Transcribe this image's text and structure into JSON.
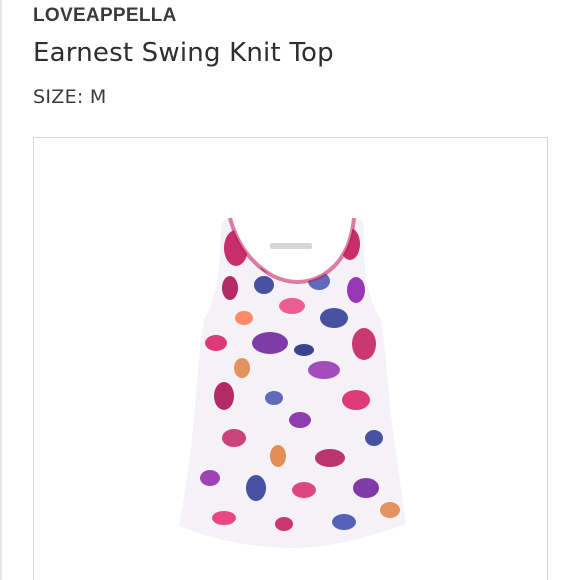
{
  "product": {
    "brand": "LOVEAPPELLA",
    "name": "Earnest Swing Knit Top",
    "size_label": "SIZE: M",
    "image": {
      "icon": "sleeveless-floral-tank-top",
      "colors": {
        "magenta": "#c2185b",
        "purple": "#6a1b9a",
        "navy": "#283593",
        "orange": "#e07b39",
        "base": "#f4f1f7"
      }
    }
  }
}
